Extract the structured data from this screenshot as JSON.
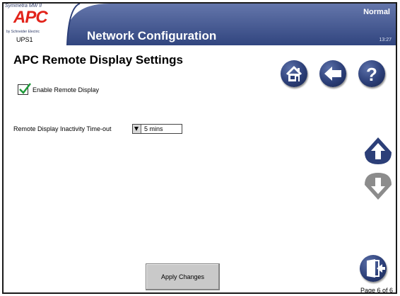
{
  "header": {
    "model": "Symmetra MW II",
    "brand": "APC",
    "manufacturer": "by Schneider Electric",
    "device": "UPS1",
    "title": "Network Configuration",
    "status": "Normal",
    "time": "13:27"
  },
  "page": {
    "heading": "APC Remote Display Settings",
    "enable_label": "Enable Remote Display",
    "enable_checked": true,
    "timeout_label": "Remote Display Inactivity Time-out",
    "timeout_value": "5 mins",
    "apply_label": "Apply Changes",
    "page_indicator": "Page 6 of 6"
  },
  "icons": {
    "home": "home-icon",
    "back": "back-arrow-icon",
    "help": "help-icon",
    "up": "arrow-up-icon",
    "down": "arrow-down-icon",
    "exit": "exit-door-icon"
  },
  "colors": {
    "header_blue": "#3a4f8c",
    "button_blue": "#2c3f78",
    "disabled": "#8c8c8c",
    "brand_red": "#e2231a"
  }
}
